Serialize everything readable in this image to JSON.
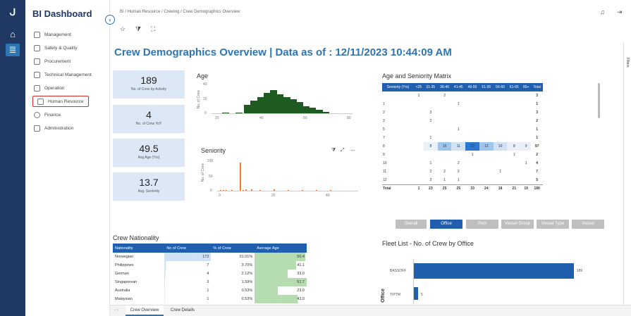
{
  "app": {
    "title": "BI Dashboard"
  },
  "breadcrumb": [
    "BI",
    "Human Resource",
    "Crewing",
    "Crew Demographics Overview"
  ],
  "sidebar": {
    "items": [
      {
        "label": "Management",
        "icon": "grid-icon"
      },
      {
        "label": "Safety & Quality",
        "icon": "ship-icon"
      },
      {
        "label": "Procurement",
        "icon": "cart-icon"
      },
      {
        "label": "Technical Management",
        "icon": "monitor-icon"
      },
      {
        "label": "Operation",
        "icon": "building-icon"
      },
      {
        "label": "Human Resource",
        "icon": "person-icon"
      },
      {
        "label": "Finance",
        "icon": "dollar-icon"
      },
      {
        "label": "Administration",
        "icon": "people-icon"
      }
    ]
  },
  "page": {
    "title": "Crew Demographics Overview | Data as of : 12/11/2023 10:44:09 AM",
    "filters_label": "Filters"
  },
  "kpis": [
    {
      "value": "189",
      "label": "No. of Crew by Activity"
    },
    {
      "value": "4",
      "label": "No. of Crew YoY"
    },
    {
      "value": "49.5",
      "label": "Avg Age (Yrs)"
    },
    {
      "value": "13.7",
      "label": "Avg. Seniority"
    }
  ],
  "age_chart": {
    "title": "Age",
    "ylabel": "No. of Crew",
    "y_ticks": [
      "40",
      "20",
      "0"
    ],
    "x_ticks": [
      "20",
      "40",
      "60",
      "80"
    ]
  },
  "seniority_chart": {
    "title": "Seniority",
    "ylabel": "No. of Crew",
    "y_ticks": [
      "100",
      "50",
      "0"
    ],
    "x_ticks": [
      "0",
      "20",
      "40"
    ]
  },
  "matrix": {
    "title": "Age and Seniority Matrix",
    "columns": [
      "Seniority (Yrs)",
      "<25",
      "31-35",
      "36-40",
      "41-45",
      "46-50",
      "51-55",
      "56-60",
      "61-65",
      "65+",
      "Total"
    ],
    "rows": [
      [
        "",
        "1",
        "",
        "2",
        "",
        "",
        "",
        "",
        "",
        "",
        "3"
      ],
      [
        "1",
        "",
        "",
        "",
        "1",
        "",
        "",
        "",
        "",
        "",
        "1"
      ],
      [
        "2",
        "",
        "3",
        "",
        "",
        "",
        "",
        "",
        "",
        "",
        "3"
      ],
      [
        "3",
        "",
        "2",
        "",
        "",
        "",
        "",
        "",
        "",
        "",
        "2"
      ],
      [
        "5",
        "",
        "",
        "",
        "1",
        "",
        "",
        "",
        "",
        "",
        "1"
      ],
      [
        "7",
        "",
        "1",
        "",
        "",
        "",
        "",
        "",
        "",
        "",
        "1"
      ],
      [
        "8",
        "",
        "8",
        "16",
        "11",
        "22",
        "12",
        "10",
        "8",
        "9",
        "97"
      ],
      [
        "9",
        "",
        "",
        "",
        "",
        "1",
        "",
        "",
        "1",
        "",
        "2"
      ],
      [
        "10",
        "",
        "1",
        "",
        "2",
        "",
        "",
        "",
        "",
        "1",
        "4"
      ],
      [
        "11",
        "",
        "2",
        "2",
        "2",
        "",
        "",
        "1",
        "",
        "",
        "7"
      ],
      [
        "12",
        "",
        "2",
        "1",
        "1",
        "",
        "",
        "",
        "",
        "",
        "5"
      ]
    ],
    "total": [
      "Total",
      "1",
      "23",
      "25",
      "25",
      "33",
      "24",
      "18",
      "21",
      "19",
      "189"
    ]
  },
  "segments": [
    "Overall",
    "Office",
    "Pool",
    "Vessel Group",
    "Vessel Type",
    "Vessel"
  ],
  "nationality": {
    "title": "Crew Nationality",
    "columns": [
      "Nationality",
      "No of Crew",
      "% of Crew",
      "Average Age"
    ],
    "rows": [
      [
        "Norwegian",
        "172",
        "91.01%",
        "50.4"
      ],
      [
        "Philippines",
        "7",
        "3.70%",
        "41.1"
      ],
      [
        "German",
        "4",
        "2.12%",
        "33.0"
      ],
      [
        "Singaporean",
        "3",
        "1.59%",
        "51.7"
      ],
      [
        "Australia",
        "1",
        "0.53%",
        "23.0"
      ],
      [
        "Malaysian",
        "1",
        "0.53%",
        "43.0"
      ]
    ]
  },
  "fleet": {
    "title": "Fleet List - No. of Crew by Office",
    "ylabel": "Office",
    "bars": [
      {
        "label": "BASSOFF",
        "value": "189"
      },
      {
        "label": "TIPTM",
        "value": "5"
      }
    ]
  },
  "tabs": [
    "Crew Overview",
    "Crew Details"
  ],
  "chart_data": [
    {
      "type": "bar",
      "title": "Age",
      "ylabel": "No. of Crew",
      "x": [
        20,
        26,
        30,
        33,
        36,
        39,
        42,
        45,
        48,
        51,
        54,
        57,
        60,
        63,
        66
      ],
      "values": [
        1,
        1,
        12,
        18,
        22,
        28,
        32,
        26,
        22,
        20,
        16,
        10,
        8,
        5,
        2
      ],
      "ylim": [
        0,
        40
      ],
      "xlim": [
        15,
        80
      ]
    },
    {
      "type": "bar",
      "title": "Seniority",
      "ylabel": "No. of Crew",
      "x": [
        1,
        2,
        3,
        5,
        8,
        9,
        10,
        12,
        15,
        20,
        25,
        30,
        35,
        40
      ],
      "values": [
        3,
        3,
        2,
        1,
        97,
        2,
        4,
        5,
        3,
        4,
        3,
        2,
        2,
        1
      ],
      "ylim": [
        0,
        100
      ],
      "xlim": [
        0,
        50
      ]
    },
    {
      "type": "bar",
      "title": "Fleet List - No. of Crew by Office",
      "ylabel": "Office",
      "categories": [
        "BASSOFF",
        "TIPTM"
      ],
      "values": [
        189,
        5
      ]
    }
  ]
}
